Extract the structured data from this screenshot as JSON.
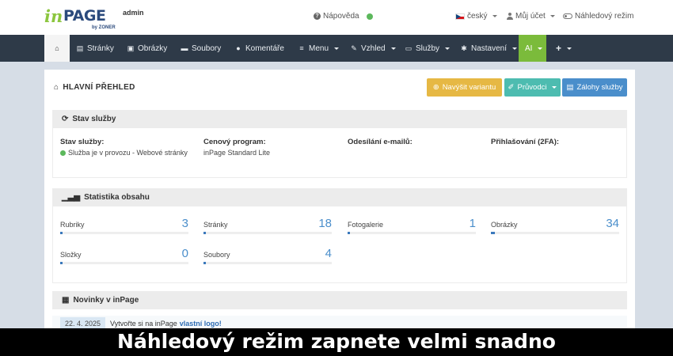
{
  "header": {
    "logo_in": "in",
    "logo_page": "PAGE",
    "logo_admin": "admin",
    "logo_by": "by ZONER",
    "help": "Nápověda",
    "language": "český",
    "account": "Můj účet",
    "preview": "Náhledový režim"
  },
  "nav": {
    "items": [
      "Stránky",
      "Obrázky",
      "Soubory",
      "Komentáře",
      "Menu",
      "Vzhled",
      "Služby",
      "Nastavení",
      "AI",
      "+"
    ]
  },
  "page": {
    "title": "HLAVNÍ PŘEHLED",
    "btn_upgrade": "Navýšit variantu",
    "btn_guides": "Průvodci",
    "btn_backups": "Zálohy služby"
  },
  "status": {
    "title": "Stav služby",
    "cols": [
      {
        "label": "Stav služby:",
        "value": "Služba je v provozu - Webové stránky"
      },
      {
        "label": "Cenový program:",
        "value": "inPage Standard Lite"
      },
      {
        "label": "Odesílání e-mailů:",
        "value": ""
      },
      {
        "label": "Přihlašování (2FA):",
        "value": ""
      }
    ]
  },
  "stats": {
    "title": "Statistika obsahu",
    "items": [
      {
        "label": "Rubriky",
        "value": "3",
        "fill": 0.02
      },
      {
        "label": "Stránky",
        "value": "18",
        "fill": 0.02
      },
      {
        "label": "Fotogalerie",
        "value": "1",
        "fill": 0.01
      },
      {
        "label": "Obrázky",
        "value": "34",
        "fill": 0.03
      },
      {
        "label": "Složky",
        "value": "0",
        "fill": 0.01
      },
      {
        "label": "Soubory",
        "value": "4",
        "fill": 0.01
      }
    ]
  },
  "news": {
    "title": "Novinky v inPage",
    "date": "22. 4. 2025",
    "text": "Vytvořte si na inPage",
    "link": "vlastní logo!"
  },
  "caption": "Náhledový režim zapnete velmi snadno",
  "colors": {
    "nav_bg": "#2e3a48",
    "ai_green": "#7bbb3b",
    "accent_blue": "#4a8ecb",
    "warn": "#e6b844",
    "teal": "#4dbcb0"
  }
}
